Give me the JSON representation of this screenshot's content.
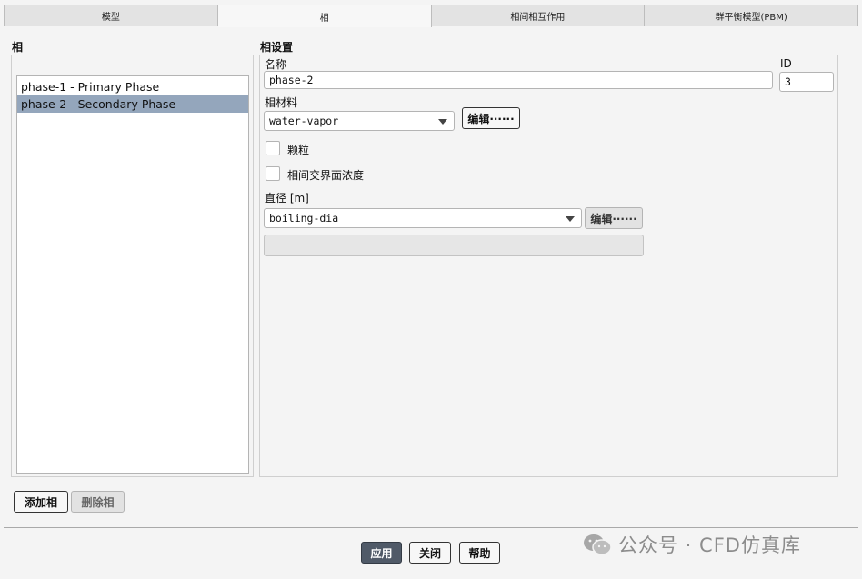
{
  "tabs": [
    "模型",
    "相",
    "相间相互作用",
    "群平衡模型(PBM)"
  ],
  "phases_panel": {
    "title": "相",
    "items": [
      "phase-1 - Primary Phase",
      "phase-2 - Secondary Phase"
    ],
    "selected_index": 1,
    "add_button": "添加相",
    "delete_button": "删除相"
  },
  "phase_settings": {
    "title": "相设置",
    "name_label": "名称",
    "name_value": "phase-2",
    "id_label": "ID",
    "id_value": "3",
    "material_label": "相材料",
    "material_value": "water-vapor",
    "edit_label": "编辑······",
    "granular_label": "颗粒",
    "interfacial_label": "相间交界面浓度",
    "diameter_label": "直径 [m]",
    "diameter_value": "boiling-dia",
    "diameter_edit_label": "编辑······"
  },
  "footer": {
    "apply": "应用",
    "close": "关闭",
    "help": "帮助"
  },
  "watermark": "公众号 · CFD仿真库",
  "icons": [
    "wechat-icon",
    "chevron-down-icon"
  ]
}
